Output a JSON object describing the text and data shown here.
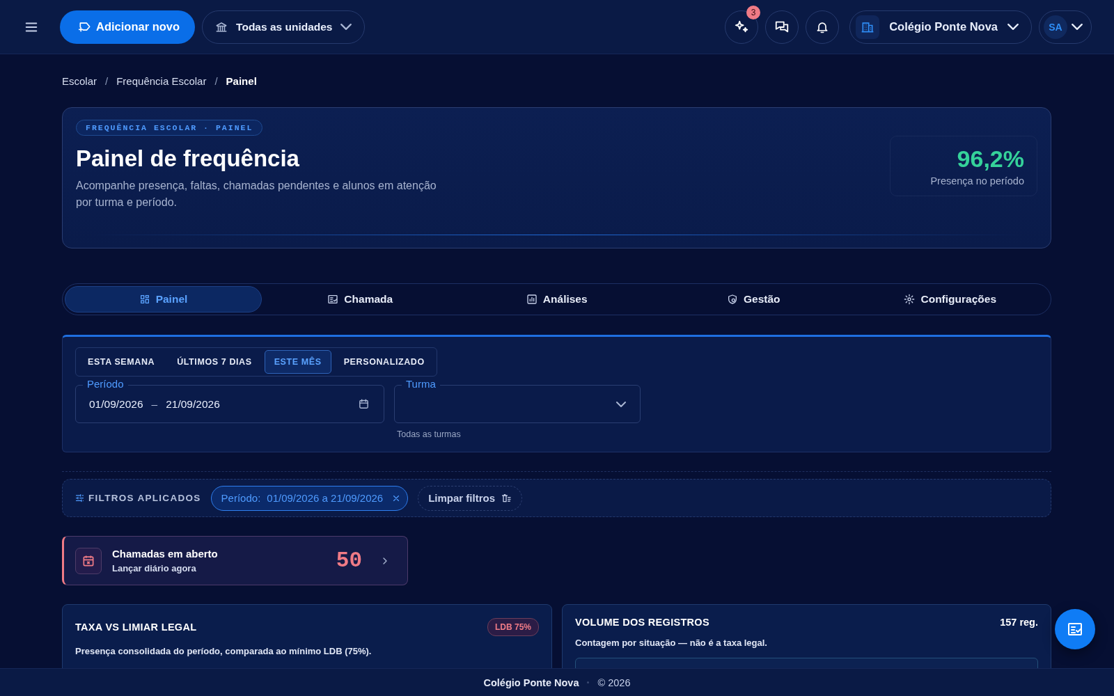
{
  "topbar": {
    "add_button": "Adicionar novo",
    "unit_selector": "Todas as unidades",
    "ai_badge": "3",
    "school": "Colégio Ponte Nova",
    "avatar": "SA"
  },
  "breadcrumb": {
    "separator": "/",
    "items": [
      {
        "label": "Escolar",
        "current": false
      },
      {
        "label": "Frequência Escolar",
        "current": false
      },
      {
        "label": "Painel",
        "current": true
      }
    ]
  },
  "hero": {
    "eyebrow": "FREQUÊNCIA ESCOLAR · PAINEL",
    "title": "Painel de frequência",
    "subtitle": "Acompanhe presença, faltas, chamadas pendentes e alunos em atenção por turma e período.",
    "stat_value": "96,2%",
    "stat_label": "Presença no período"
  },
  "tabs": [
    {
      "label": "Painel",
      "selected": true
    },
    {
      "label": "Chamada",
      "selected": false
    },
    {
      "label": "Análises",
      "selected": false
    },
    {
      "label": "Gestão",
      "selected": false
    },
    {
      "label": "Configurações",
      "selected": false
    }
  ],
  "filters": {
    "presets": [
      {
        "label": "ESTA SEMANA",
        "selected": false
      },
      {
        "label": "ÚLTIMOS 7 DIAS",
        "selected": false
      },
      {
        "label": "ESTE MÊS",
        "selected": true
      },
      {
        "label": "PERSONALIZADO",
        "selected": false
      }
    ],
    "period": {
      "label": "Período",
      "start": "01/09/2026",
      "separator": "–",
      "end": "21/09/2026"
    },
    "class": {
      "label": "Turma",
      "helper": "Todas as turmas"
    }
  },
  "applied": {
    "title": "FILTROS APLICADOS",
    "chips": [
      {
        "key": "Período:",
        "value": "01/09/2026 a 21/09/2026"
      }
    ],
    "clear": "Limpar filtros"
  },
  "alert": {
    "title": "Chamadas em aberto",
    "subtitle": "Lançar diário agora",
    "count": "50"
  },
  "cards": [
    {
      "kind": "rate",
      "title": "TAXA VS LIMIAR LEGAL",
      "badge": "LDB 75%",
      "description": "Presença consolidada do período, comparada ao mínimo LDB (75%)."
    },
    {
      "kind": "volume",
      "title": "VOLUME DOS REGISTROS",
      "meta": "157 reg.",
      "description": "Contagem por situação — não é a taxa legal."
    }
  ],
  "footer": {
    "school": "Colégio Ponte Nova",
    "copyright": "© 2026"
  }
}
